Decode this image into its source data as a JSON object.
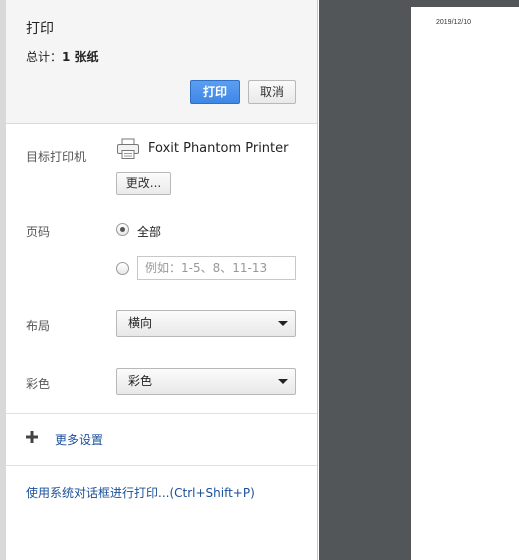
{
  "header": {
    "title": "打印",
    "summary_label": "总计：",
    "summary_value": "1 张纸",
    "print_button": "打印",
    "cancel_button": "取消"
  },
  "destination": {
    "label": "目标打印机",
    "printer_name": "Foxit Phantom Printer",
    "change_button": "更改..."
  },
  "pages": {
    "label": "页码",
    "option_all": "全部",
    "option_custom_placeholder": "例如：1-5、8、11-13",
    "selected": "all"
  },
  "layout": {
    "label": "布局",
    "value": "横向"
  },
  "color": {
    "label": "彩色",
    "value": "彩色"
  },
  "more_settings": "更多设置",
  "system_dialog_link": "使用系统对话框进行打印...(Ctrl+Shift+P)",
  "preview": {
    "date": "2019/12/10"
  },
  "colors": {
    "primary": "#4a90e2",
    "link": "#1a4f9a",
    "preview_background": "#525659"
  }
}
